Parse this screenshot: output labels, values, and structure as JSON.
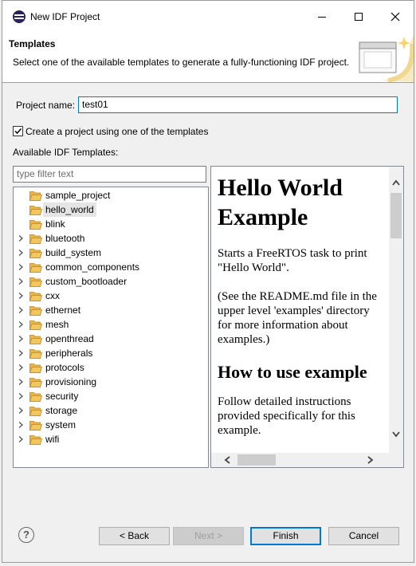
{
  "window": {
    "title": "New IDF Project"
  },
  "header": {
    "title": "Templates",
    "description": "Select one of the available templates to generate a fully-functioning IDF project."
  },
  "form": {
    "project_name_label": "Project name:",
    "project_name_value": "test01",
    "use_template_label": "Create a project using one of the templates",
    "use_template_checked": true,
    "available_templates_label": "Available IDF Templates:",
    "filter_placeholder": "type filter text"
  },
  "templates": [
    {
      "label": "sample_project",
      "expandable": false,
      "selected": false
    },
    {
      "label": "hello_world",
      "expandable": false,
      "selected": true
    },
    {
      "label": "blink",
      "expandable": false,
      "selected": false
    },
    {
      "label": "bluetooth",
      "expandable": true,
      "selected": false
    },
    {
      "label": "build_system",
      "expandable": true,
      "selected": false
    },
    {
      "label": "common_components",
      "expandable": true,
      "selected": false
    },
    {
      "label": "custom_bootloader",
      "expandable": true,
      "selected": false
    },
    {
      "label": "cxx",
      "expandable": true,
      "selected": false
    },
    {
      "label": "ethernet",
      "expandable": true,
      "selected": false
    },
    {
      "label": "mesh",
      "expandable": true,
      "selected": false
    },
    {
      "label": "openthread",
      "expandable": true,
      "selected": false
    },
    {
      "label": "peripherals",
      "expandable": true,
      "selected": false
    },
    {
      "label": "protocols",
      "expandable": true,
      "selected": false
    },
    {
      "label": "provisioning",
      "expandable": true,
      "selected": false
    },
    {
      "label": "security",
      "expandable": true,
      "selected": false
    },
    {
      "label": "storage",
      "expandable": true,
      "selected": false
    },
    {
      "label": "system",
      "expandable": true,
      "selected": false
    },
    {
      "label": "wifi",
      "expandable": true,
      "selected": false
    }
  ],
  "preview": {
    "heading": "Hello World Example",
    "paragraph1": "Starts a FreeRTOS task to print \"Hello World\".",
    "paragraph2": "(See the README.md file in the upper level 'examples' directory for more information about examples.)",
    "subheading": "How to use example",
    "paragraph3": "Follow detailed instructions provided specifically for this example."
  },
  "buttons": {
    "help": "?",
    "back": "< Back",
    "next": "Next >",
    "finish": "Finish",
    "cancel": "Cancel"
  },
  "colors": {
    "accent": "#0078d7",
    "folder": "#e8b64a",
    "folder_open": "#f3c75f"
  }
}
